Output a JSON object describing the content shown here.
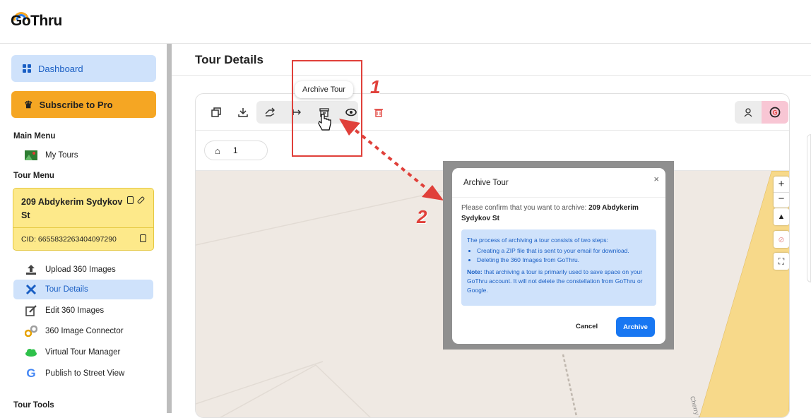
{
  "app": {
    "logo": "GoThru"
  },
  "sidebar": {
    "dashboard_label": "Dashboard",
    "subscribe_label": "Subscribe to Pro",
    "main_menu_heading": "Main Menu",
    "my_tours_label": "My Tours",
    "tour_menu_heading": "Tour Menu",
    "tour_card": {
      "name": "209 Abdykerim Sydykov St",
      "cid": "CID: 6655832263404097290"
    },
    "items": [
      {
        "label": "Upload 360 Images",
        "icon": "upload-icon"
      },
      {
        "label": "Tour Details",
        "icon": "tools-icon",
        "active": true
      },
      {
        "label": "Edit 360 Images",
        "icon": "edit-icon"
      },
      {
        "label": "360 Image Connector",
        "icon": "link-icon"
      },
      {
        "label": "Virtual Tour Manager",
        "icon": "cloud-icon"
      },
      {
        "label": "Publish to Street View",
        "icon": "google-icon"
      }
    ],
    "tour_tools_heading": "Tour Tools"
  },
  "main": {
    "title": "Tour Details",
    "tooltip": "Archive Tour",
    "breadcrumb_count": "1",
    "annotations": {
      "step1": "1",
      "step2": "2"
    },
    "map_street_label": "Cherry S"
  },
  "modal": {
    "title": "Archive Tour",
    "close": "×",
    "confirm_text": "Please confirm that you want to archive:",
    "tour_name": "209 Abdykerim Sydykov St",
    "info_intro": "The process of archiving a tour consists of two steps:",
    "info_steps": [
      "Creating a ZIP file that is sent to your email for download.",
      "Deleting the 360 Images from GoThru."
    ],
    "note_label": "Note:",
    "note_text": "that archiving a tour is primarily used to save space on your GoThru account. It will not delete the constellation from GoThru or Google.",
    "cancel_label": "Cancel",
    "archive_label": "Archive"
  },
  "colors": {
    "accent": "#1877f2",
    "pro": "#f5a623",
    "annotation": "#e0403a",
    "active_bg": "#cfe2fb"
  }
}
